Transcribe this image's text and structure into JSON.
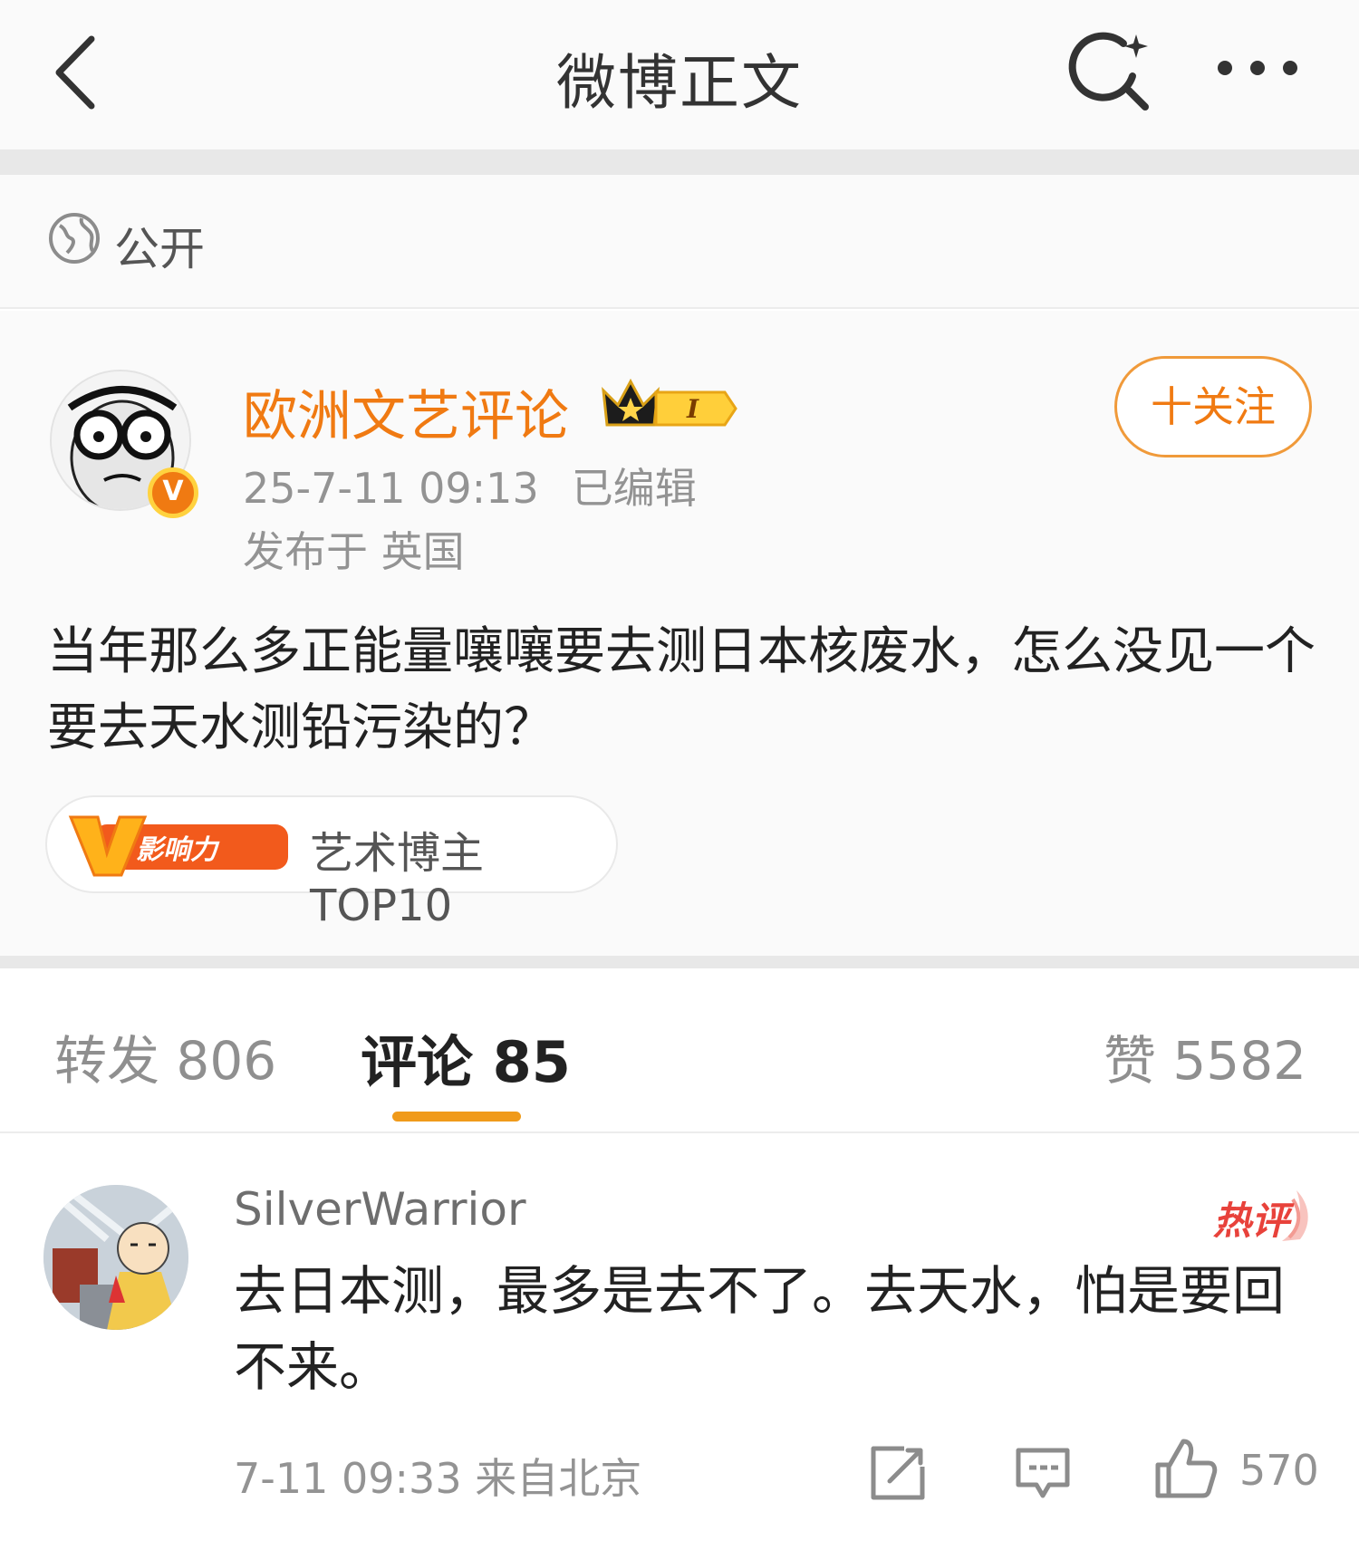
{
  "nav": {
    "title": "微博正文"
  },
  "visibility": {
    "label": "公开"
  },
  "post": {
    "username": "欧洲文艺评论",
    "level_badge": "I",
    "verified_badge": "V",
    "time": "25-7-11 09:13",
    "edited": "已编辑",
    "location": "发布于 英国",
    "follow_label": "十关注",
    "text": "当年那么多正能量嚷嚷要去测日本核废水，怎么没见一个要去天水测铅污染的？",
    "tag": {
      "badge": "影响力",
      "badge_letter": "V",
      "text": "艺术博主TOP10"
    }
  },
  "tabs": {
    "repost": "转发 806",
    "comment": "评论 85",
    "like": "赞 5582"
  },
  "comment": {
    "username": "SilverWarrior",
    "hot_label": "热评",
    "text": "去日本测，最多是去不了。去天水，怕是要回不来。",
    "meta": "7-11 09:33 来自北京",
    "like_count": "570"
  },
  "colors": {
    "accent": "#f07a12",
    "tab_underline": "#f09a1a",
    "hot_red": "#e8423b"
  }
}
